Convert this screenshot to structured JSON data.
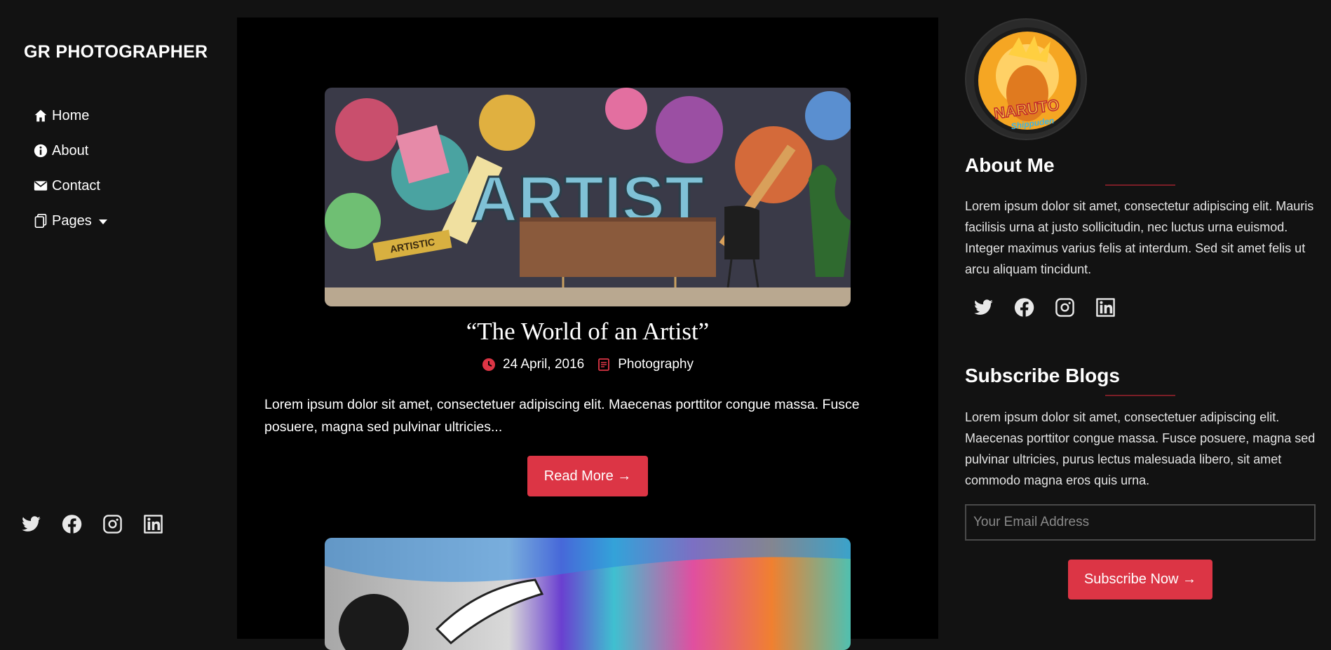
{
  "brand": "GR PHOTOGRAPHER",
  "nav": {
    "home": "Home",
    "about": "About",
    "contact": "Contact",
    "pages": "Pages"
  },
  "post": {
    "title": "“The World of an Artist”",
    "date": "24 April, 2016",
    "category": "Photography",
    "excerpt": "Lorem ipsum dolor sit amet, consectetuer adipiscing elit. Maecenas porttitor congue massa. Fusce posuere, magna sed pulvinar ultricies...",
    "read_more": "Read More →",
    "image_text": "ARTIST",
    "banner_text": "ARTISTIC"
  },
  "about": {
    "heading": "About Me",
    "text": "Lorem ipsum dolor sit amet, consectetur adipiscing elit. Mauris facilisis urna at justo sollicitudin, nec luctus urna euismod. Integer maximus varius felis at interdum. Sed sit amet felis ut arcu aliquam tincidunt.",
    "avatar_text": "NARUTO",
    "avatar_subtext": "Shippuden"
  },
  "subscribe": {
    "heading": "Subscribe Blogs",
    "text": "Lorem ipsum dolor sit amet, consectetuer adipiscing elit. Maecenas porttitor congue massa. Fusce posuere, magna sed pulvinar ultricies, purus lectus malesuada libero, sit amet commodo magna eros quis urna.",
    "placeholder": "Your Email Address",
    "button": "Subscribe Now →"
  },
  "colors": {
    "accent": "#dc3545",
    "background": "#121212",
    "main_bg": "#000000"
  },
  "icons": [
    "home-icon",
    "info-icon",
    "envelope-icon",
    "pages-icon",
    "twitter-icon",
    "facebook-icon",
    "instagram-icon",
    "linkedin-icon",
    "clock-icon",
    "document-icon"
  ]
}
